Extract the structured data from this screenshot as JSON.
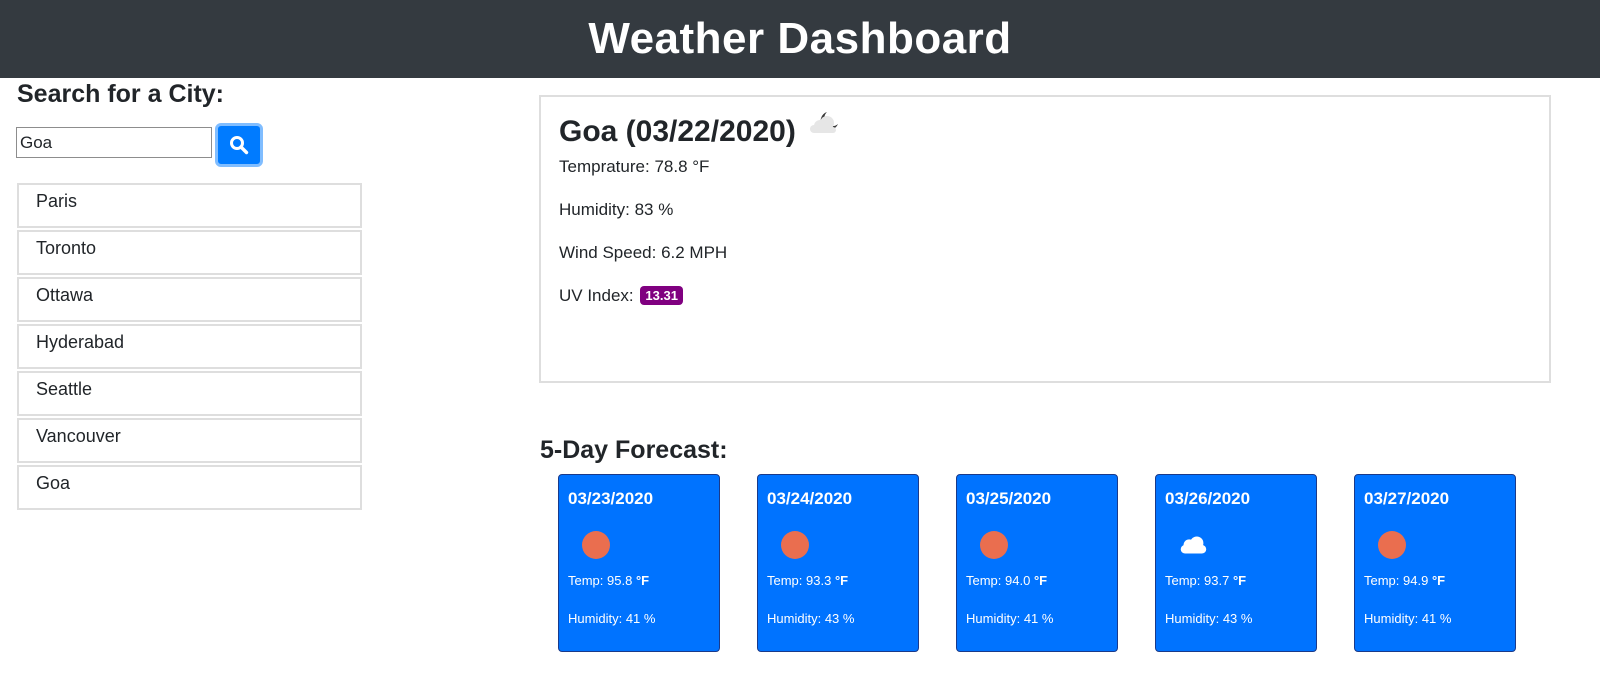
{
  "header": {
    "title": "Weather Dashboard"
  },
  "search": {
    "heading": "Search for a City:",
    "input_value": "Goa",
    "button_icon": "search-icon"
  },
  "history": {
    "cities": [
      "Paris",
      "Toronto",
      "Ottawa",
      "Hyderabad",
      "Seattle",
      "Vancouver",
      "Goa"
    ]
  },
  "current": {
    "title": "Goa (03/22/2020)",
    "icon": "partly-cloudy-night-icon",
    "temp_label": "Temprature:",
    "temp_value": "78.8 °F",
    "humidity_label": "Humidity:",
    "humidity_value": "83 %",
    "wind_label": "Wind Speed:",
    "wind_value": "6.2 MPH",
    "uv_label": "UV Index:",
    "uv_value": "13.31",
    "uv_color": "#800080"
  },
  "forecast": {
    "heading": "5-Day Forecast:",
    "temp_label": "Temp:",
    "temp_unit": "°F",
    "humidity_label": "Humidity:",
    "card_color": "#0073ff",
    "days": [
      {
        "date": "03/23/2020",
        "icon": "sun-icon",
        "temp": "95.8",
        "humidity": "41 %"
      },
      {
        "date": "03/24/2020",
        "icon": "sun-icon",
        "temp": "93.3",
        "humidity": "43 %"
      },
      {
        "date": "03/25/2020",
        "icon": "sun-icon",
        "temp": "94.0",
        "humidity": "41 %"
      },
      {
        "date": "03/26/2020",
        "icon": "cloud-icon",
        "temp": "93.7",
        "humidity": "43 %"
      },
      {
        "date": "03/27/2020",
        "icon": "sun-icon",
        "temp": "94.9",
        "humidity": "41 %"
      }
    ]
  }
}
